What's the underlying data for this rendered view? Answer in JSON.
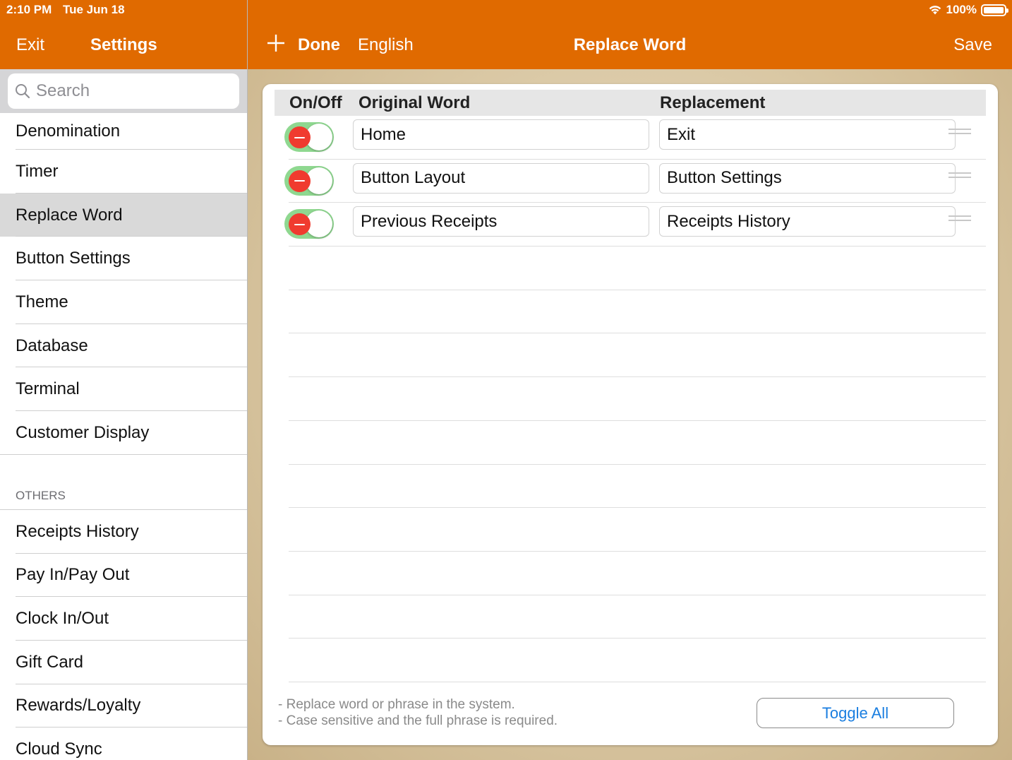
{
  "status_bar": {
    "time": "2:10 PM",
    "date": "Tue Jun 18",
    "battery": "100%"
  },
  "sidebar_nav": {
    "exit_label": "Exit",
    "title": "Settings"
  },
  "search": {
    "placeholder": "Search",
    "value": ""
  },
  "sidebar": {
    "items": [
      {
        "label": "Denomination"
      },
      {
        "label": "Timer"
      },
      {
        "label": "Replace Word",
        "selected": true
      },
      {
        "label": "Button Settings"
      },
      {
        "label": "Theme"
      },
      {
        "label": "Database"
      },
      {
        "label": "Terminal"
      },
      {
        "label": "Customer Display"
      }
    ],
    "others_header": "OTHERS",
    "others": [
      {
        "label": "Receipts History"
      },
      {
        "label": "Pay In/Pay Out"
      },
      {
        "label": "Clock In/Out"
      },
      {
        "label": "Gift Card"
      },
      {
        "label": "Rewards/Loyalty"
      },
      {
        "label": "Cloud Sync"
      }
    ]
  },
  "toolbar": {
    "add_icon": "plus-icon",
    "done_label": "Done",
    "language_label": "English",
    "title": "Replace Word",
    "save_label": "Save"
  },
  "table": {
    "headers": {
      "onoff": "On/Off",
      "original": "Original Word",
      "replacement": "Replacement"
    },
    "rows": [
      {
        "enabled": true,
        "original": "Home",
        "replacement": "Exit"
      },
      {
        "enabled": true,
        "original": "Button Layout",
        "replacement": "Button Settings"
      },
      {
        "enabled": true,
        "original": "Previous Receipts",
        "replacement": "Receipts History"
      }
    ]
  },
  "notes": {
    "line1": "- Replace word or phrase in the system.",
    "line2": "- Case sensitive and the full phrase is required."
  },
  "toggle_all_label": "Toggle All",
  "colors": {
    "accent": "#e06a00",
    "toggle_on": "#8fd890",
    "delete": "#f03b2f",
    "link": "#1a7ee0"
  }
}
